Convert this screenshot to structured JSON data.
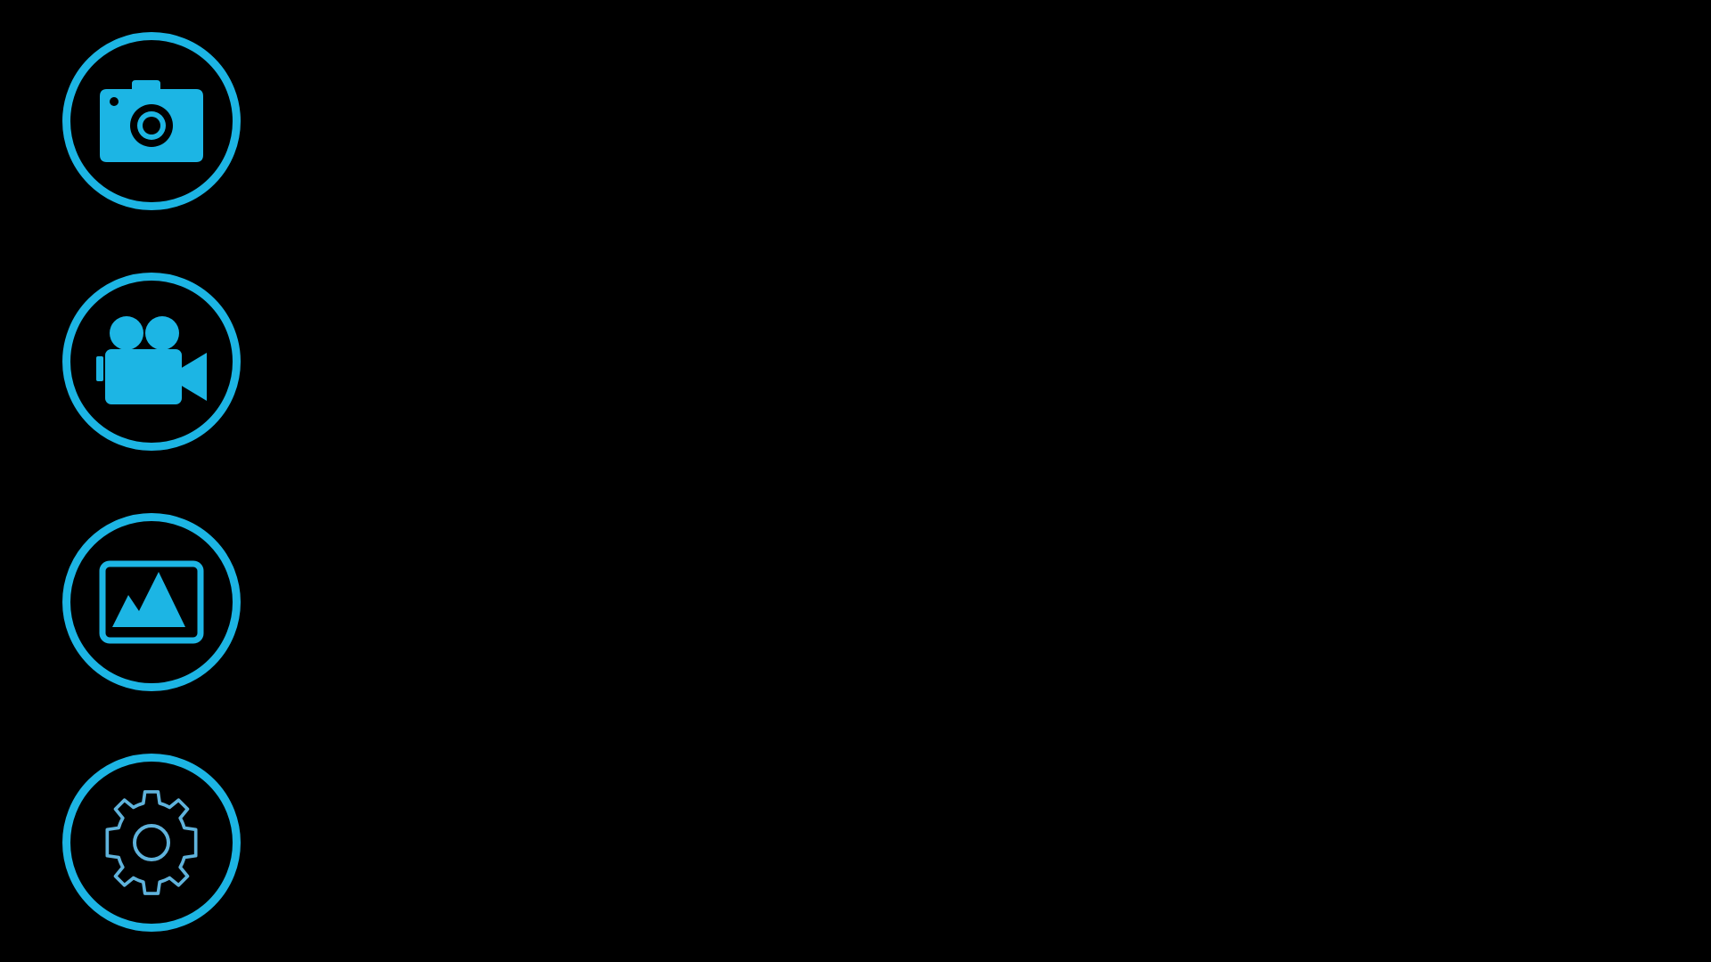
{
  "theme": {
    "background": "#000000",
    "accent": "#1cb5e4",
    "gear_outline": "#5fb3dc"
  },
  "side_menu": {
    "items": [
      {
        "id": "camera",
        "icon": "camera-icon"
      },
      {
        "id": "video",
        "icon": "video-camera-icon"
      },
      {
        "id": "gallery",
        "icon": "image-gallery-icon"
      },
      {
        "id": "settings",
        "icon": "gear-icon"
      }
    ]
  }
}
